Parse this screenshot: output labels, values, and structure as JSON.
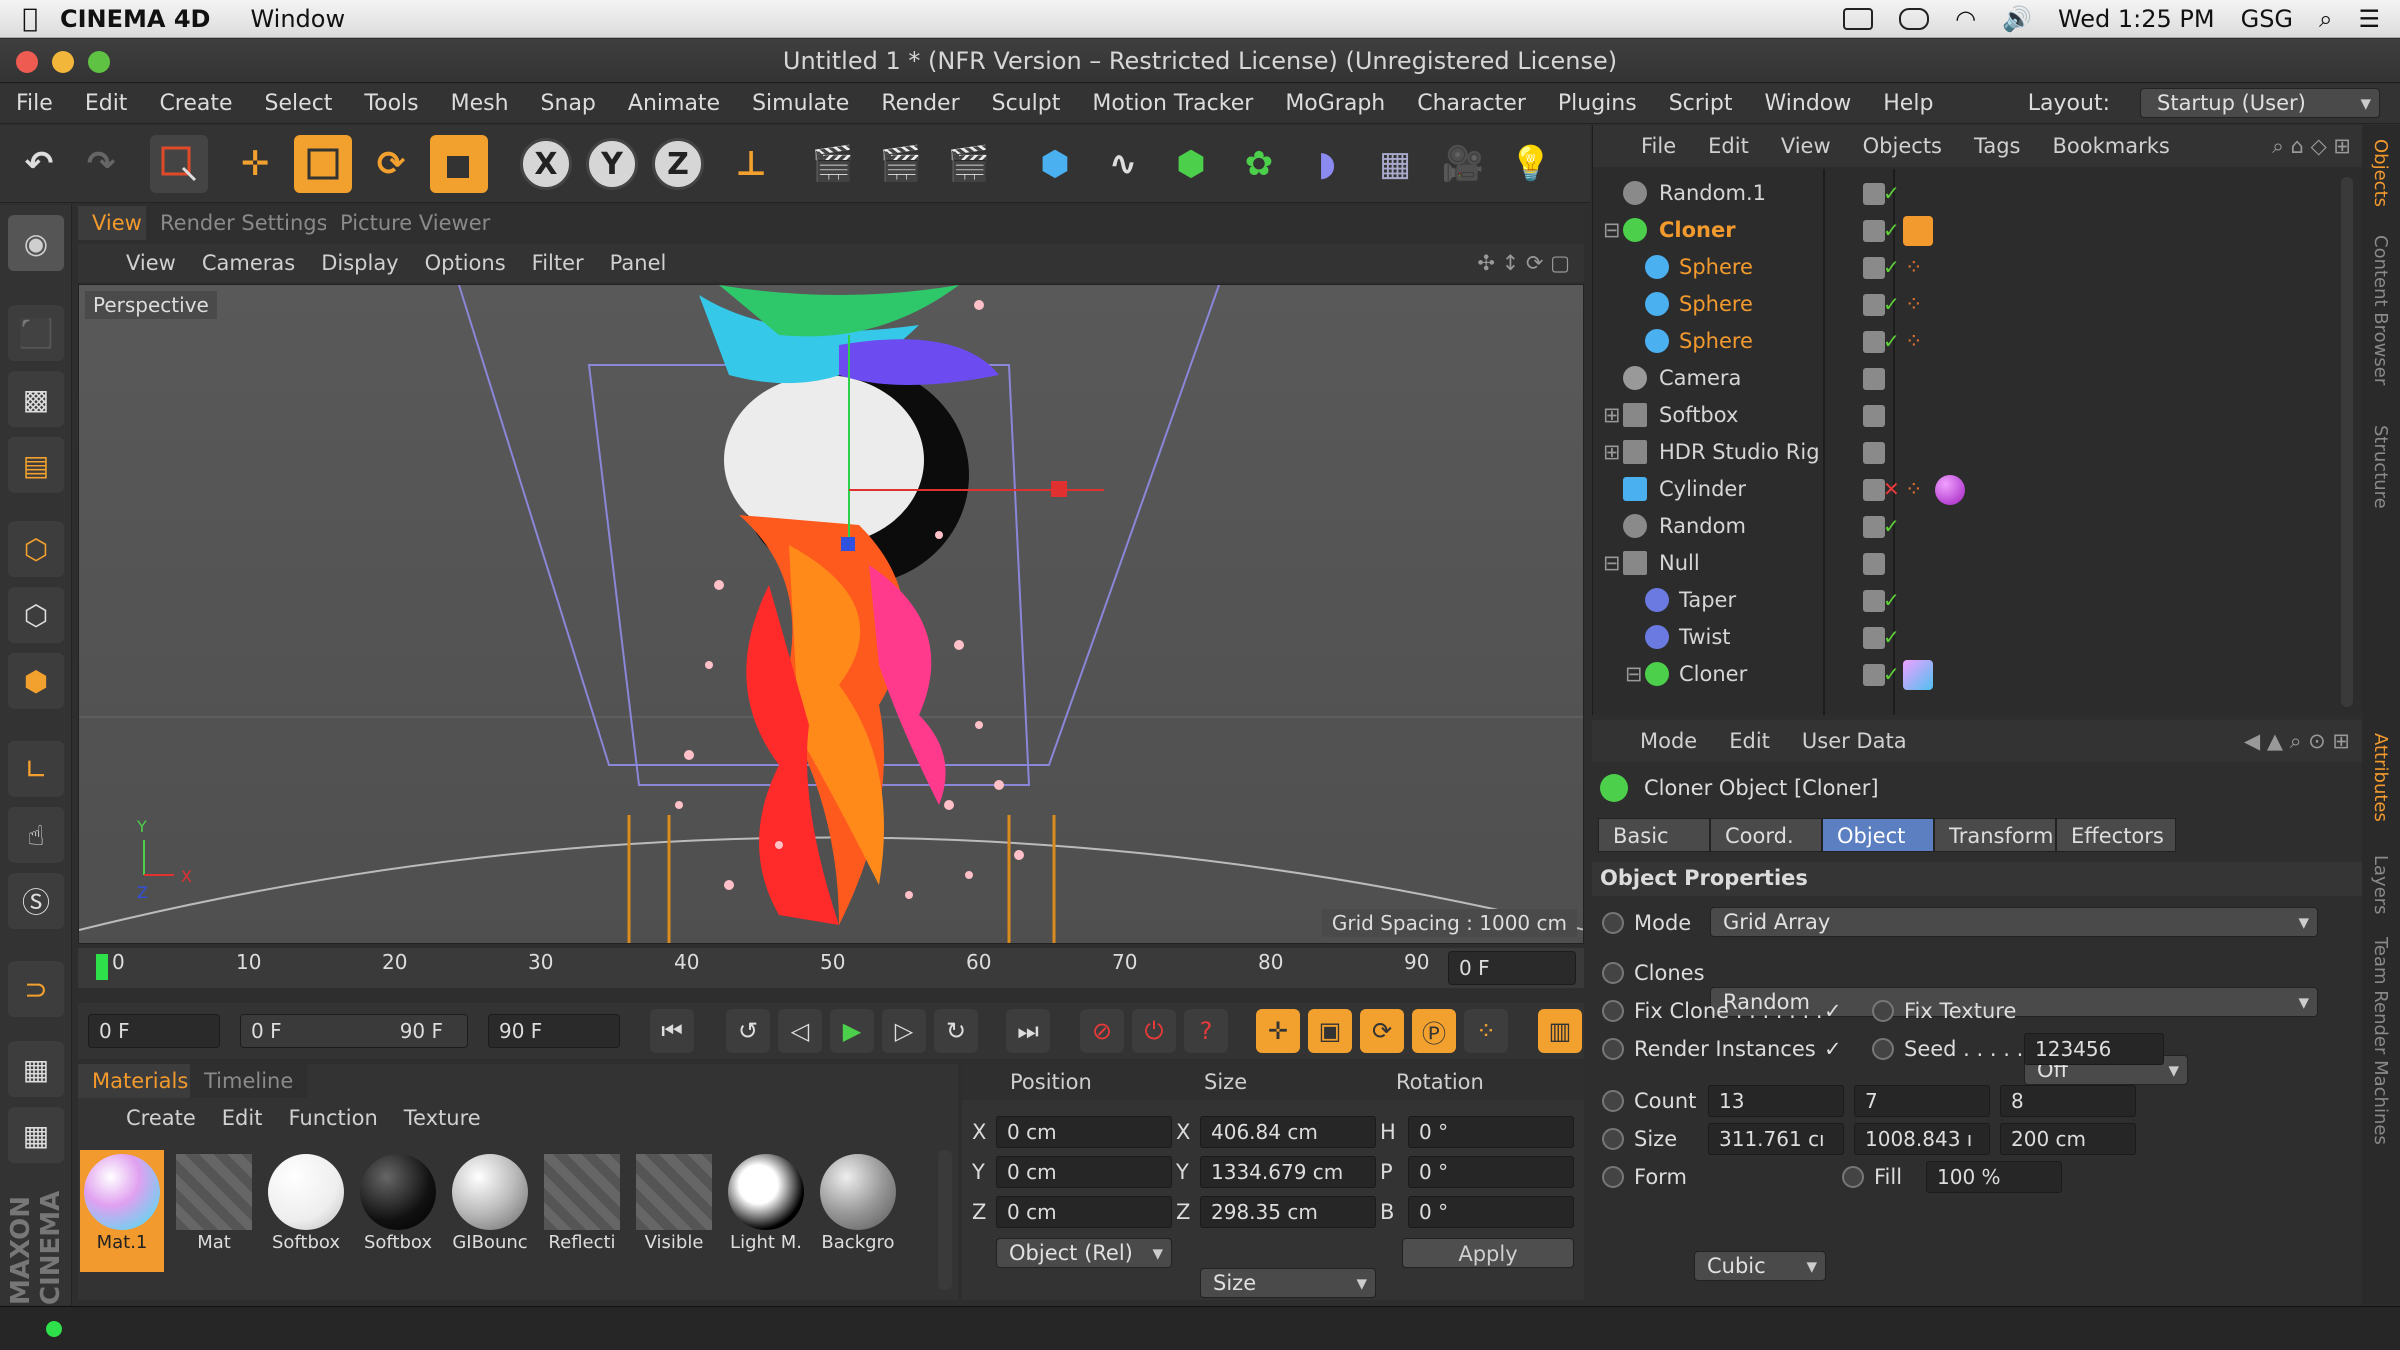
{
  "mac": {
    "app": "CINEMA 4D",
    "window": "Window",
    "clock": "Wed 1:25 PM",
    "user": "GSG"
  },
  "title": "Untitled 1 * (NFR Version – Restricted License) (Unregistered License)",
  "menu": [
    "File",
    "Edit",
    "Create",
    "Select",
    "Tools",
    "Mesh",
    "Snap",
    "Animate",
    "Simulate",
    "Render",
    "Sculpt",
    "Motion Tracker",
    "MoGraph",
    "Character",
    "Plugins",
    "Script",
    "Window",
    "Help"
  ],
  "layout": {
    "label": "Layout:",
    "value": "Startup (User)"
  },
  "toolbar": {
    "x": "X",
    "y": "Y",
    "z": "Z"
  },
  "viewtabs": [
    "View",
    "Render Settings",
    "Picture Viewer"
  ],
  "viewmenu": [
    "View",
    "Cameras",
    "Display",
    "Options",
    "Filter",
    "Panel"
  ],
  "viewport": {
    "label": "Perspective",
    "grid": "Grid Spacing : 1000 cm",
    "axis_y": "Y",
    "axis_x": "X",
    "axis_z": "Z"
  },
  "timeline": {
    "ticks": [
      "0",
      "10",
      "20",
      "30",
      "40",
      "50",
      "60",
      "70",
      "80",
      "90"
    ],
    "frame": "0 F"
  },
  "transport": {
    "start": "0 F",
    "range_start": "0 F",
    "range_end": "90 F",
    "end": "90 F"
  },
  "matpanel": {
    "tabs": [
      "Materials",
      "Timeline"
    ],
    "menu": [
      "Create",
      "Edit",
      "Function",
      "Texture"
    ],
    "materials": [
      "Mat.1",
      "Mat",
      "Softbox",
      "Softbox",
      "GIBounc",
      "Reflecti",
      "Visible",
      "Light M.",
      "Backgro"
    ]
  },
  "coords": {
    "headers": [
      "Position",
      "Size",
      "Rotation"
    ],
    "rows": [
      {
        "axis": "X",
        "pos": "0 cm",
        "saxis": "X",
        "size": "406.84 cm",
        "raxis": "H",
        "rot": "0 °"
      },
      {
        "axis": "Y",
        "pos": "0 cm",
        "saxis": "Y",
        "size": "1334.679 cm",
        "raxis": "P",
        "rot": "0 °"
      },
      {
        "axis": "Z",
        "pos": "0 cm",
        "saxis": "Z",
        "size": "298.35 cm",
        "raxis": "B",
        "rot": "0 °"
      }
    ],
    "mode": "Object (Rel)",
    "sizemode": "Size",
    "apply": "Apply"
  },
  "objmenu": [
    "File",
    "Edit",
    "View",
    "Objects",
    "Tags",
    "Bookmarks"
  ],
  "objects": [
    {
      "name": "Random.1",
      "color": "#d6d6d6",
      "indent": 0,
      "check": "✓",
      "hl": false
    },
    {
      "name": "Cloner",
      "color": "#f29a2e",
      "indent": 0,
      "check": "✓",
      "hl": true
    },
    {
      "name": "Sphere",
      "color": "#f29a2e",
      "indent": 1,
      "check": "✓",
      "hl": true
    },
    {
      "name": "Sphere",
      "color": "#f29a2e",
      "indent": 1,
      "check": "✓",
      "hl": true
    },
    {
      "name": "Sphere",
      "color": "#f29a2e",
      "indent": 1,
      "check": "✓",
      "hl": true
    },
    {
      "name": "Camera",
      "color": "#d6d6d6",
      "indent": 0,
      "check": "",
      "hl": false
    },
    {
      "name": "Softbox",
      "color": "#d6d6d6",
      "indent": 0,
      "check": "",
      "hl": false
    },
    {
      "name": "HDR Studio Rig",
      "color": "#d6d6d6",
      "indent": 0,
      "check": "",
      "hl": false
    },
    {
      "name": "Cylinder",
      "color": "#d6d6d6",
      "indent": 0,
      "check": "✕",
      "hl": false
    },
    {
      "name": "Random",
      "color": "#d6d6d6",
      "indent": 0,
      "check": "✓",
      "hl": false
    },
    {
      "name": "Null",
      "color": "#d6d6d6",
      "indent": 0,
      "check": "",
      "hl": false
    },
    {
      "name": "Taper",
      "color": "#d6d6d6",
      "indent": 1,
      "check": "✓",
      "hl": false
    },
    {
      "name": "Twist",
      "color": "#d6d6d6",
      "indent": 1,
      "check": "✓",
      "hl": false
    },
    {
      "name": "Cloner",
      "color": "#d6d6d6",
      "indent": 1,
      "check": "✓",
      "hl": false
    }
  ],
  "attr": {
    "menu": [
      "Mode",
      "Edit",
      "User Data"
    ],
    "title": "Cloner Object [Cloner]",
    "tabs": [
      "Basic",
      "Coord.",
      "Object",
      "Transform",
      "Effectors"
    ],
    "section": "Object Properties",
    "mode_label": "Mode",
    "mode_value": "Grid Array",
    "clones_label": "Clones",
    "clones_value": "Random",
    "fixclone": "Fix Clone . . . . . . .",
    "fixclone_check": "✓",
    "fixtexture": "Fix Texture",
    "fixtexture_value": "Off",
    "render": "Render Instances",
    "render_check": "✓",
    "seed": "Seed . . . . . .",
    "seed_value": "123456",
    "count": "Count",
    "count_values": [
      "13",
      "7",
      "8"
    ],
    "size": "Size",
    "size_values": [
      "311.761 cı",
      "1008.843 ı",
      "200 cm"
    ],
    "form": "Form",
    "form_value": "Cubic",
    "fill": "Fill",
    "fill_value": "100 %"
  },
  "rightstrip": [
    "Objects",
    "Content Browser",
    "Structure",
    "Attributes",
    "Layers",
    "Team Render Machines"
  ],
  "brand": "MAXON CINEMA"
}
